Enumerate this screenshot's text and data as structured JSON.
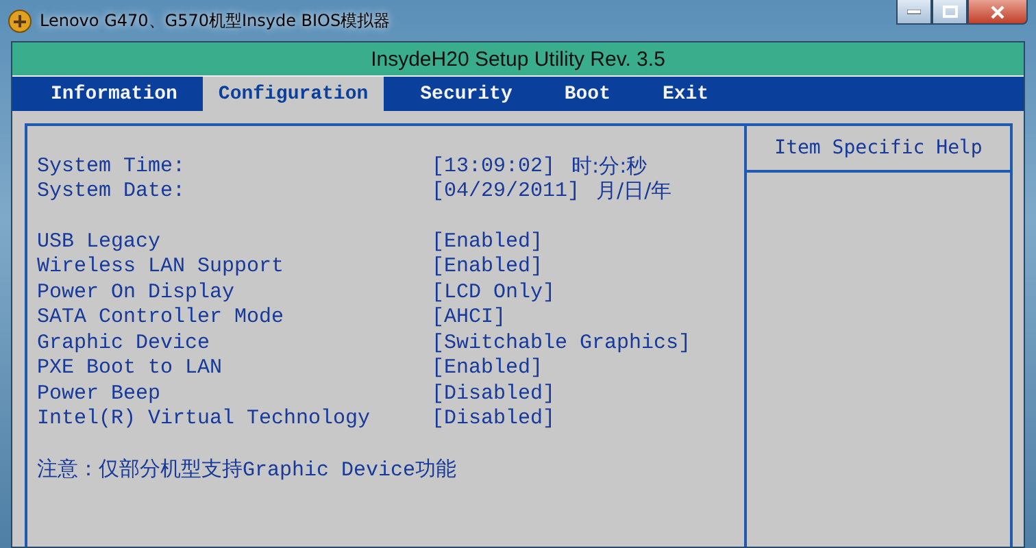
{
  "window": {
    "title": "Lenovo G470、G570机型Insyde BIOS模拟器"
  },
  "header": {
    "title": "InsydeH20 Setup Utility Rev. 3.5"
  },
  "tabs": [
    {
      "label": "Information",
      "selected": false
    },
    {
      "label": "Configuration",
      "selected": true
    },
    {
      "label": "Security",
      "selected": false
    },
    {
      "label": "Boot",
      "selected": false
    },
    {
      "label": "Exit",
      "selected": false
    }
  ],
  "settings": [
    {
      "group": [
        {
          "label": "System Time:",
          "value": "[13:09:02]",
          "hint": "时:分:秒"
        },
        {
          "label": "System Date:",
          "value": "[04/29/2011]",
          "hint": "月/日/年"
        }
      ]
    },
    {
      "group": [
        {
          "label": "USB Legacy",
          "value": "[Enabled]"
        },
        {
          "label": "Wireless LAN Support",
          "value": "[Enabled]"
        },
        {
          "label": "Power On Display",
          "value": "[LCD Only]"
        },
        {
          "label": "SATA Controller Mode",
          "value": "[AHCI]"
        },
        {
          "label": "Graphic Device",
          "value": "[Switchable Graphics]"
        },
        {
          "label": "PXE Boot to LAN",
          "value": "[Enabled]"
        },
        {
          "label": "Power Beep",
          "value": "[Disabled]"
        },
        {
          "label": "Intel(R) Virtual Technology",
          "value": "[Disabled]"
        }
      ]
    }
  ],
  "note": "注意：仅部分机型支持Graphic Device功能",
  "help": {
    "title": "Item Specific Help"
  }
}
